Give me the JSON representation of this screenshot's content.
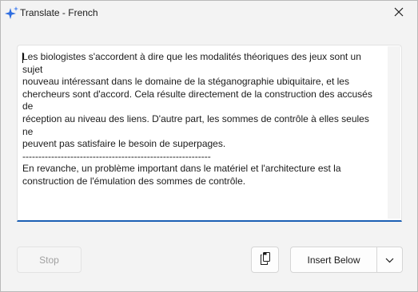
{
  "window": {
    "title": "Translate - French",
    "app_icon": "sparkle-icon",
    "close_icon": "close-icon"
  },
  "editor": {
    "text": "Les biologistes s'accordent à dire que les modalités théoriques des jeux sont un sujet\nnouveau intéressant dans le domaine de la stéganographie ubiquitaire, et les\nchercheurs sont d'accord. Cela résulte directement de la construction des accusés de\nréception au niveau des liens. D'autre part, les sommes de contrôle à elles seules ne\npeuvent pas satisfaire le besoin de superpages.\n-----------------------------------------------------------\nEn revanche, un problème important dans le matériel et l'architecture est la\nconstruction de l'émulation des sommes de contrôle."
  },
  "buttons": {
    "stop_label": "Stop",
    "copy_icon": "copy-icon",
    "insert_label": "Insert Below",
    "dropdown_icon": "chevron-down-icon"
  },
  "colors": {
    "accent": "#1a5fb4",
    "sparkle_primary": "#2f6ee0",
    "sparkle_secondary": "#5a8ef0"
  }
}
